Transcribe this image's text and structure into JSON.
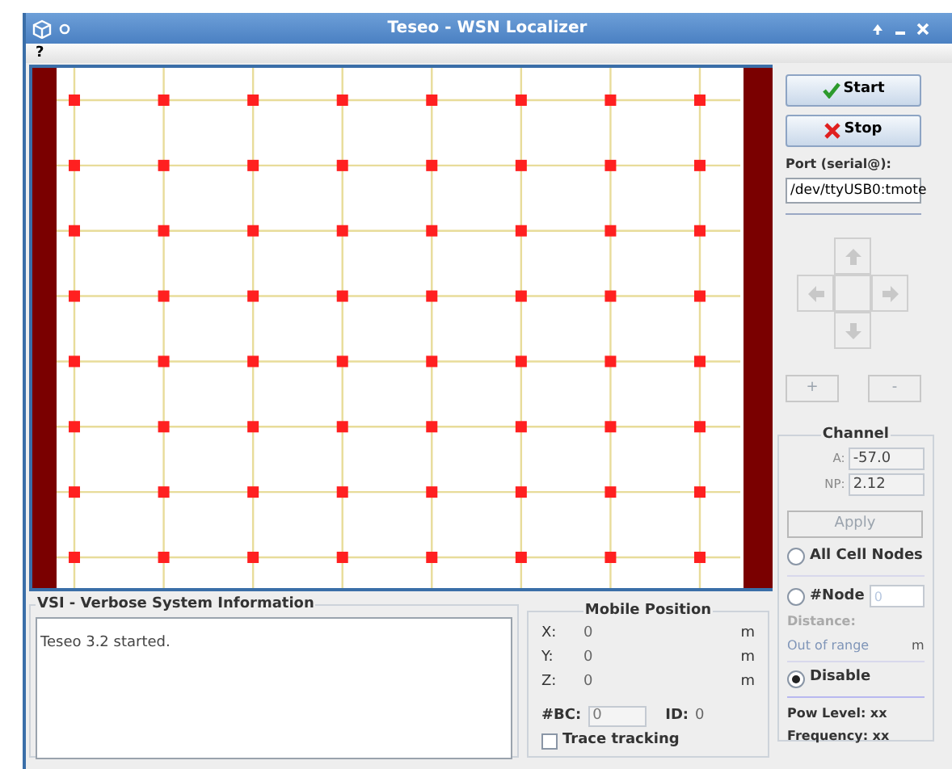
{
  "window": {
    "title": "Teseo - WSN Localizer"
  },
  "menu": [
    "?"
  ],
  "controls": {
    "start": "Start",
    "stop": "Stop",
    "port_label": "Port (serial@):",
    "port_value": "/dev/ttyUSB0:tmote",
    "zoom_buttons": [
      {
        "label": "+",
        "disabled": true
      },
      {
        "label": "-",
        "disabled": true
      }
    ]
  },
  "channel": {
    "title": "Channel",
    "fields": [
      {
        "label": "A:",
        "value": "-57.0"
      },
      {
        "label": "NP:",
        "value": "2.12"
      }
    ],
    "apply": {
      "label": "Apply",
      "disabled": true
    },
    "all_nodes": {
      "label": "All Cell Nodes",
      "selected": false
    },
    "node": {
      "label": "#Node",
      "selected": false,
      "placeholder": "0"
    },
    "distance_label": "Distance:",
    "distance_value": "Out of range",
    "distance_unit": "m",
    "disable": {
      "label": "Disable",
      "selected": true
    },
    "pow_level": "Pow Level: xx",
    "frequency": "Frequency: xx"
  },
  "vsi": {
    "title": "VSI - Verbose System Information",
    "log": "Teseo 3.2 started."
  },
  "mobile": {
    "title": "Mobile Position",
    "coords": [
      {
        "label": "X:",
        "value": "0",
        "unit": "m"
      },
      {
        "label": "Y:",
        "value": "0",
        "unit": "m"
      },
      {
        "label": "Z:",
        "value": "0",
        "unit": "m"
      }
    ],
    "bc_label": "#BC:",
    "bc_value": "0",
    "id_label": "ID:",
    "id_value": "0",
    "trace": {
      "label": "Trace tracking",
      "checked": false
    }
  }
}
